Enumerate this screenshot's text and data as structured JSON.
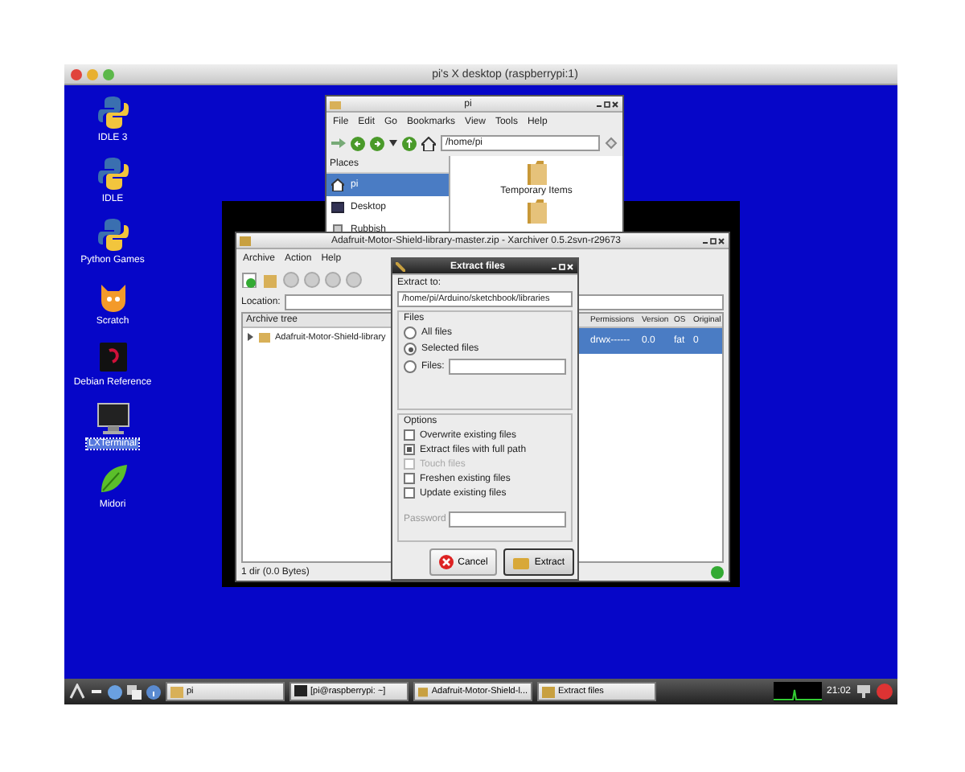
{
  "outer_window": {
    "title": "pi's X desktop (raspberrypi:1)"
  },
  "desktop_icons": [
    {
      "label": "IDLE 3",
      "kind": "python",
      "selected": false
    },
    {
      "label": "IDLE",
      "kind": "python",
      "selected": false
    },
    {
      "label": "Python Games",
      "kind": "python",
      "selected": false
    },
    {
      "label": "Scratch",
      "kind": "scratch",
      "selected": false
    },
    {
      "label": "Debian Reference",
      "kind": "debian",
      "selected": false
    },
    {
      "label": "LXTerminal",
      "kind": "terminal",
      "selected": true
    },
    {
      "label": "Midori",
      "kind": "browser",
      "selected": false
    }
  ],
  "file_manager": {
    "title": "pi",
    "menu": [
      "File",
      "Edit",
      "Go",
      "Bookmarks",
      "View",
      "Tools",
      "Help"
    ],
    "path": "/home/pi",
    "places_header": "Places",
    "places": [
      {
        "label": "pi",
        "kind": "home",
        "selected": true
      },
      {
        "label": "Desktop",
        "kind": "desktop",
        "selected": false
      },
      {
        "label": "Rubbish",
        "kind": "bin",
        "selected": false
      }
    ],
    "files": [
      "Temporary Items"
    ]
  },
  "archiver": {
    "title": "Adafruit-Motor-Shield-library-master.zip - Xarchiver 0.5.2svn-r29673",
    "menu": [
      "Archive",
      "Action",
      "Help"
    ],
    "location_label": "Location:",
    "tree_header": "Archive tree",
    "tree_items": [
      {
        "label": "Adafruit-Motor-Shield-library",
        "expanded": false
      }
    ],
    "columns": [
      "Permissions",
      "Version",
      "OS",
      "Original"
    ],
    "rows": [
      {
        "cells": [
          "drwx------",
          "0.0",
          "fat",
          "0"
        ],
        "selected": true
      }
    ],
    "status": "1 dir (0.0 Bytes)"
  },
  "dialog": {
    "title": "Extract files",
    "extract_to_label": "Extract to:",
    "extract_to": "/home/pi/Arduino/sketchbook/libraries",
    "files_label": "Files",
    "file_choices": [
      {
        "label": "All files",
        "kind": "radio",
        "selected": false
      },
      {
        "label": "Selected files",
        "kind": "radio",
        "selected": true
      },
      {
        "label": "Files:",
        "kind": "field",
        "selected": false
      }
    ],
    "options_label": "Options",
    "options": [
      {
        "label": "Overwrite existing files",
        "checked": false,
        "disabled": false
      },
      {
        "label": "Extract files with full path",
        "checked": true,
        "disabled": false
      },
      {
        "label": "Touch files",
        "checked": false,
        "disabled": true
      },
      {
        "label": "Freshen existing files",
        "checked": false,
        "disabled": false
      },
      {
        "label": "Update existing files",
        "checked": false,
        "disabled": false
      }
    ],
    "password_label": "Password",
    "buttons": [
      {
        "label": "Cancel",
        "kind": "cancel"
      },
      {
        "label": "Extract",
        "kind": "extract"
      }
    ]
  },
  "taskbar": {
    "tasks": [
      {
        "label": "pi",
        "kind": "folder"
      },
      {
        "label": "[pi@raspberrypi: ~]",
        "kind": "terminal"
      },
      {
        "label": "Adafruit-Motor-Shield-l...",
        "kind": "archive"
      },
      {
        "label": "Extract files",
        "kind": "archive"
      }
    ],
    "clock": "21:02"
  }
}
